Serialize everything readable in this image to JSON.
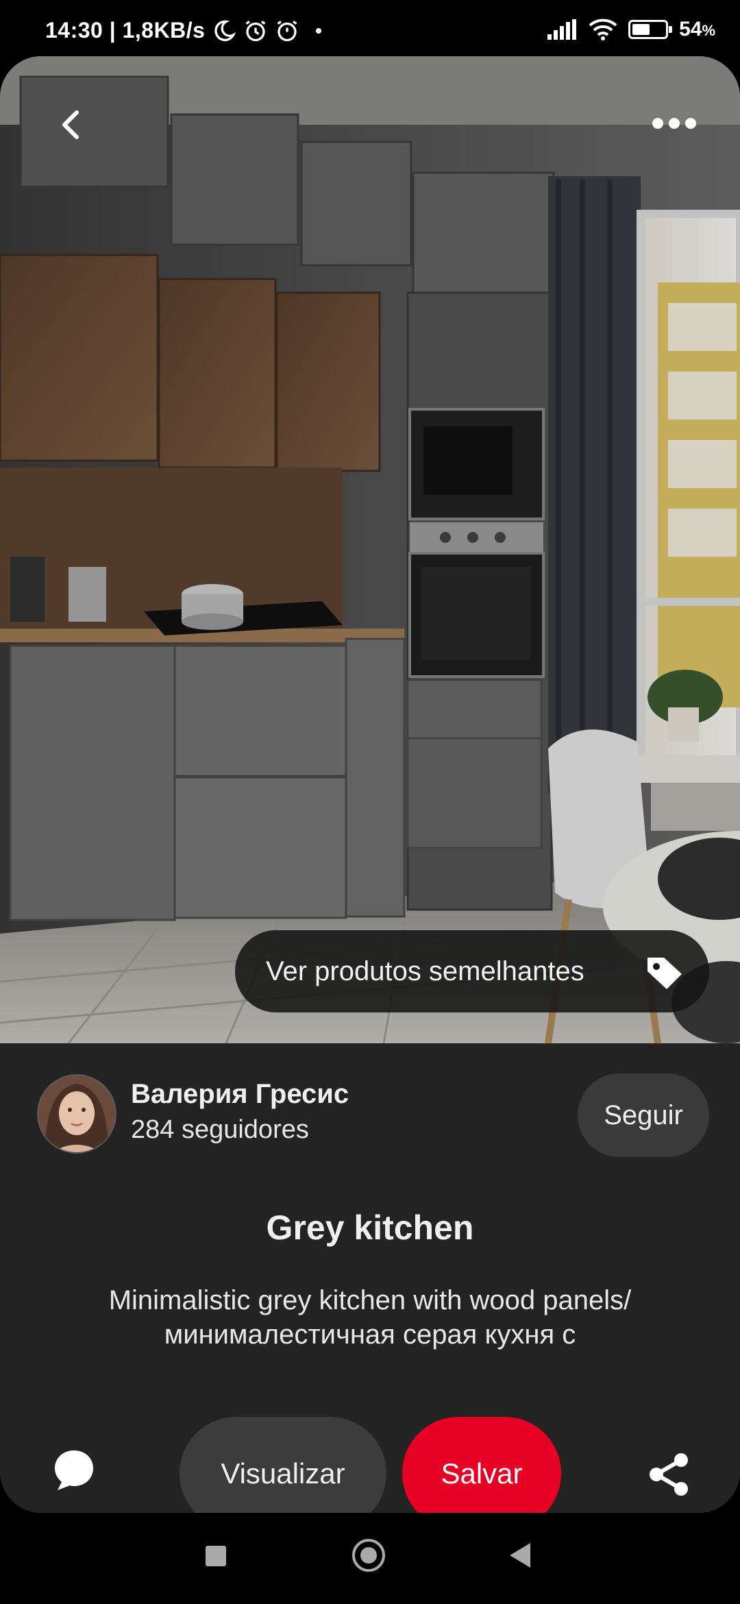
{
  "status_bar": {
    "time_speed": "14:30 | 1,8KB/s",
    "battery_percent": "54",
    "battery_unit": "%",
    "battery_level": 0.54,
    "icons": [
      "moon-icon",
      "alarm-icon",
      "alarm-off-icon",
      "signal-icon",
      "wifi-icon",
      "battery-icon"
    ]
  },
  "pin": {
    "image_alt": "Grey kitchen",
    "similar_products_label": "Ver produtos semelhantes",
    "title": "Grey kitchen",
    "description": "Minimalistic grey kitchen with wood panels/ минималестичная серая кухня с"
  },
  "author": {
    "name": "Валерия Гресис",
    "followers": "284 seguidores",
    "follow_label": "Seguir"
  },
  "actions": {
    "view_label": "Visualizar",
    "save_label": "Salvar"
  },
  "colors": {
    "save_button": "#e60023",
    "panel_background": "#232323",
    "pill_background": "#3c3c3c"
  }
}
